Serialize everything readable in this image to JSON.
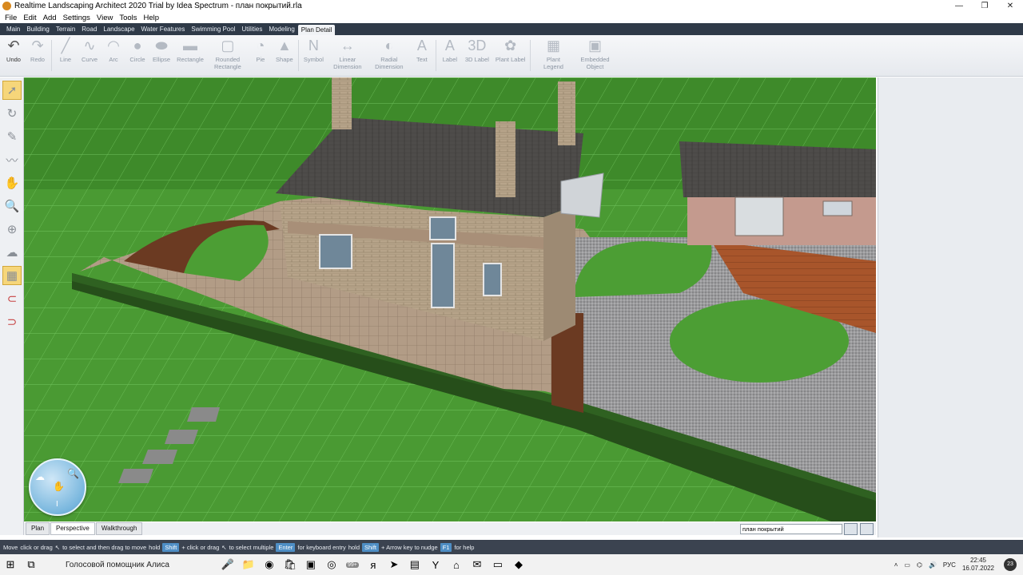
{
  "window": {
    "title": "Realtime Landscaping Architect 2020 Trial by Idea Spectrum - план покрытий.rla",
    "minimize": "—",
    "maximize": "❐",
    "close": "✕"
  },
  "menu": [
    "File",
    "Edit",
    "Add",
    "Settings",
    "View",
    "Tools",
    "Help"
  ],
  "tabs": [
    "Main",
    "Building",
    "Terrain",
    "Road",
    "Landscape",
    "Water Features",
    "Swimming Pool",
    "Utilities",
    "Modeling",
    "Plan Detail"
  ],
  "active_tab": "Plan Detail",
  "ribbon": [
    {
      "label": "Undo",
      "icon": "undo-icon",
      "glyph": "↶",
      "enabled": true
    },
    {
      "label": "Redo",
      "icon": "redo-icon",
      "glyph": "↷",
      "enabled": false
    },
    {
      "label": "Line",
      "icon": "line-icon",
      "glyph": "╱",
      "enabled": false
    },
    {
      "label": "Curve",
      "icon": "curve-icon",
      "glyph": "∿",
      "enabled": false
    },
    {
      "label": "Arc",
      "icon": "arc-icon",
      "glyph": "◠",
      "enabled": false
    },
    {
      "label": "Circle",
      "icon": "circle-icon",
      "glyph": "●",
      "enabled": false
    },
    {
      "label": "Ellipse",
      "icon": "ellipse-icon",
      "glyph": "⬬",
      "enabled": false
    },
    {
      "label": "Rectangle",
      "icon": "rectangle-icon",
      "glyph": "▬",
      "enabled": false
    },
    {
      "label": "Rounded Rectangle",
      "icon": "rounded-rectangle-icon",
      "glyph": "▢",
      "enabled": false
    },
    {
      "label": "Pie",
      "icon": "pie-icon",
      "glyph": "◔",
      "enabled": false
    },
    {
      "label": "Shape",
      "icon": "shape-icon",
      "glyph": "▲",
      "enabled": false
    },
    {
      "label": "Symbol",
      "icon": "symbol-icon",
      "glyph": "N",
      "enabled": false
    },
    {
      "label": "Linear Dimension",
      "icon": "linear-dimension-icon",
      "glyph": "↔",
      "enabled": false
    },
    {
      "label": "Radial Dimension",
      "icon": "radial-dimension-icon",
      "glyph": "◐",
      "enabled": false
    },
    {
      "label": "Text",
      "icon": "text-icon",
      "glyph": "A",
      "enabled": false
    },
    {
      "label": "Label",
      "icon": "label-icon",
      "glyph": "A",
      "enabled": false
    },
    {
      "label": "3D Label",
      "icon": "3d-label-icon",
      "glyph": "3D",
      "enabled": false
    },
    {
      "label": "Plant Label",
      "icon": "plant-label-icon",
      "glyph": "✿",
      "enabled": false
    },
    {
      "label": "Plant Legend",
      "icon": "plant-legend-icon",
      "glyph": "▦",
      "enabled": false
    },
    {
      "label": "Embedded Object",
      "icon": "embedded-object-icon",
      "glyph": "▣",
      "enabled": false
    }
  ],
  "left_tools": [
    {
      "name": "select-tool",
      "glyph": "➚",
      "selected": true
    },
    {
      "name": "rotate-tool",
      "glyph": "↻"
    },
    {
      "name": "edit-tool",
      "glyph": "✎"
    },
    {
      "name": "draw-tool",
      "glyph": "〰"
    },
    {
      "name": "pan-tool",
      "glyph": "✋"
    },
    {
      "name": "zoom-tool",
      "glyph": "🔍"
    },
    {
      "name": "zoom-extents-tool",
      "glyph": "⊕"
    },
    {
      "name": "orbit-tool",
      "glyph": "☁"
    },
    {
      "name": "grid-tool",
      "glyph": "▦",
      "selected": true
    },
    {
      "name": "magnet-tool",
      "glyph": "⊂",
      "red": true
    },
    {
      "name": "snap-tool",
      "glyph": "⊃",
      "red": true
    }
  ],
  "view_tabs": [
    "Plan",
    "Perspective",
    "Walkthrough"
  ],
  "active_view": "Perspective",
  "plan_select": "план покрытий",
  "status": {
    "mode": "Move",
    "parts": [
      {
        "text": "click or drag",
        "key": false
      },
      {
        "text": "↖",
        "key": false
      },
      {
        "text": "to select and then drag to move",
        "key": false
      },
      {
        "text": "hold",
        "key": false
      },
      {
        "text": "Shift",
        "key": true
      },
      {
        "text": "+ click or drag",
        "key": false
      },
      {
        "text": "↖",
        "key": false
      },
      {
        "text": "to select multiple",
        "key": false
      },
      {
        "text": "Enter",
        "key": true
      },
      {
        "text": "for keyboard entry",
        "key": false
      },
      {
        "text": "hold",
        "key": false
      },
      {
        "text": "Shift",
        "key": true
      },
      {
        "text": "+ Arrow key to nudge",
        "key": false
      },
      {
        "text": "F1",
        "key": true
      },
      {
        "text": "for help",
        "key": false
      }
    ]
  },
  "taskbar": {
    "search_text": "Голосовой помощник Алиса",
    "badge_mail": "99+",
    "lang": "РУС",
    "time": "22:45",
    "date": "16.07.2022",
    "notifications": "23"
  }
}
